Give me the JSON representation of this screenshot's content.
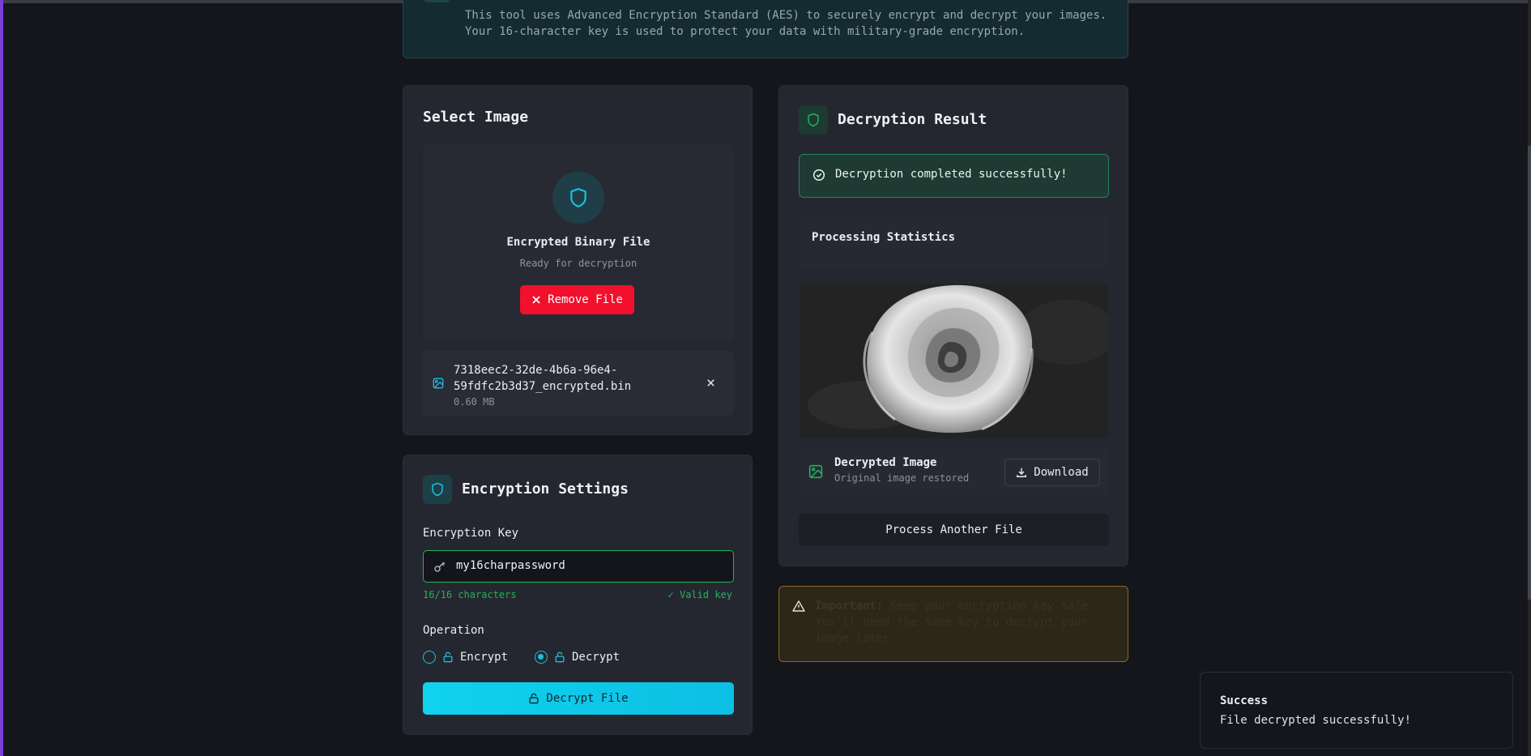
{
  "info_banner": {
    "text": "This tool uses Advanced Encryption Standard (AES) to securely encrypt and decrypt your images. Your 16-character key is used to protect your data with military-grade encryption."
  },
  "select_image": {
    "title": "Select Image",
    "file_type": "Encrypted Binary File",
    "file_status": "Ready for decryption",
    "remove_label": "Remove File",
    "file": {
      "name": "7318eec2-32de-4b6a-96e4-59fdfc2b3d37_encrypted.bin",
      "size": "0.60 MB"
    }
  },
  "settings": {
    "title": "Encryption Settings",
    "key_label": "Encryption Key",
    "key_value": "my16charpassword",
    "char_count": "16/16 characters",
    "valid_text": "✓ Valid key",
    "operation_label": "Operation",
    "encrypt_label": "Encrypt",
    "decrypt_label": "Decrypt",
    "selected_operation": "Decrypt",
    "action_label": "Decrypt File"
  },
  "result": {
    "title": "Decryption Result",
    "success_text": "Decryption completed successfully!",
    "stats_title": "Processing Statistics",
    "image_title": "Decrypted Image",
    "image_sub": "Original image restored",
    "download_label": "Download",
    "process_label": "Process Another File"
  },
  "warning": {
    "strong": "Important:",
    "text": " Keep your encryption key safe. You'll need the same key to decrypt your image later."
  },
  "toast": {
    "title": "Success",
    "message": "File decrypted successfully!"
  },
  "colors": {
    "accent": "#10d2ee",
    "success": "#22b35c",
    "danger": "#f2102d",
    "warning": "#8a6a1f"
  }
}
